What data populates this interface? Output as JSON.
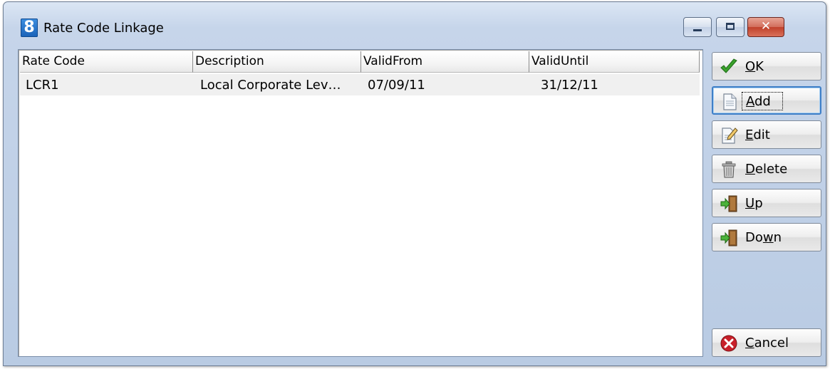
{
  "window": {
    "title": "Rate Code Linkage",
    "app_icon_glyph": "8",
    "close_glyph": "✕"
  },
  "list": {
    "columns": [
      "Rate Code",
      "Description",
      "ValidFrom",
      "ValidUntil"
    ],
    "rows": [
      [
        "LCR1",
        "Local Corporate Lev…",
        "07/09/11",
        "31/12/11"
      ]
    ]
  },
  "buttons": {
    "ok": {
      "label": "OK",
      "accel": "O",
      "icon": "checkmark-icon"
    },
    "add": {
      "label": "Add",
      "accel": "A",
      "icon": "document-icon"
    },
    "edit": {
      "label": "Edit",
      "accel": "E",
      "icon": "edit-document-icon"
    },
    "delete": {
      "label": "Delete",
      "accel": "D",
      "icon": "trash-icon"
    },
    "up": {
      "label": "Up",
      "accel": "U",
      "icon": "door-arrow-icon"
    },
    "down": {
      "label": "Down",
      "accel": "w",
      "icon": "door-arrow-icon"
    },
    "cancel": {
      "label": "Cancel",
      "accel": "C",
      "icon": "cancel-icon"
    }
  },
  "colors": {
    "accent_focus": "#3f7fc7",
    "check_green": "#3aa12c",
    "cancel_red": "#c8202a"
  }
}
